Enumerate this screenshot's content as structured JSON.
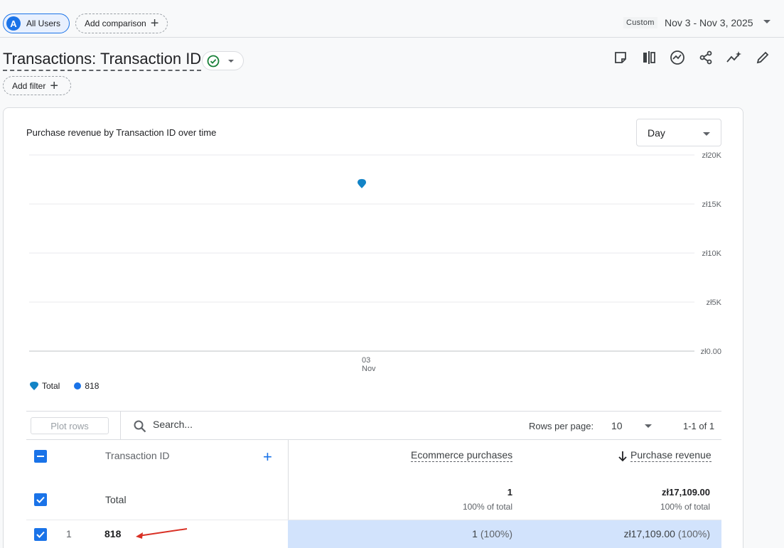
{
  "segment": {
    "avatar_letter": "A",
    "label": "All Users"
  },
  "comparison": {
    "label": "Add comparison"
  },
  "date": {
    "tag": "Custom",
    "range": "Nov 3 - Nov 3, 2025"
  },
  "report": {
    "title": "Transactions: Transaction ID",
    "add_filter": "Add filter"
  },
  "toolbar": [
    "note-icon",
    "compare-icon",
    "insights-icon",
    "share-icon",
    "trend-icon",
    "edit-icon"
  ],
  "chart": {
    "title": "Purchase revenue by Transaction ID over time",
    "granularity": "Day",
    "legend": [
      {
        "name": "Total",
        "icon": "pin"
      },
      {
        "name": "818",
        "icon": "dot"
      }
    ],
    "accent": "#1a73e8",
    "total_color": "#1283c6"
  },
  "chart_data": {
    "type": "scatter",
    "title": "Purchase revenue by Transaction ID over time",
    "x": [
      "03 Nov"
    ],
    "x_tick_labels": [
      [
        "03",
        "Nov"
      ]
    ],
    "y_ticks": [
      "zł20K",
      "zł15K",
      "zł10K",
      "zł5K",
      "zł0.00"
    ],
    "ylim": [
      0,
      20000
    ],
    "series": [
      {
        "name": "Total",
        "values": [
          17109
        ]
      }
    ],
    "grid": true,
    "y_axis_side": "right"
  },
  "table": {
    "plot_rows": "Plot rows",
    "search_placeholder": "Search...",
    "rows_per_page_label": "Rows per page:",
    "rows_per_page": "10",
    "pagination": "1-1 of 1",
    "dimension_header": "Transaction ID",
    "metric_headers": [
      "Ecommerce purchases",
      "Purchase revenue"
    ],
    "total": {
      "label": "Total",
      "purchases": "1",
      "purchases_pct": "100% of total",
      "revenue": "zł17,109.00",
      "revenue_pct": "100% of total"
    },
    "rows": [
      {
        "index": "1",
        "id": "818",
        "purchases": "1",
        "purchases_pct": "(100%)",
        "revenue": "zł17,109.00",
        "revenue_pct": "(100%)"
      }
    ]
  }
}
